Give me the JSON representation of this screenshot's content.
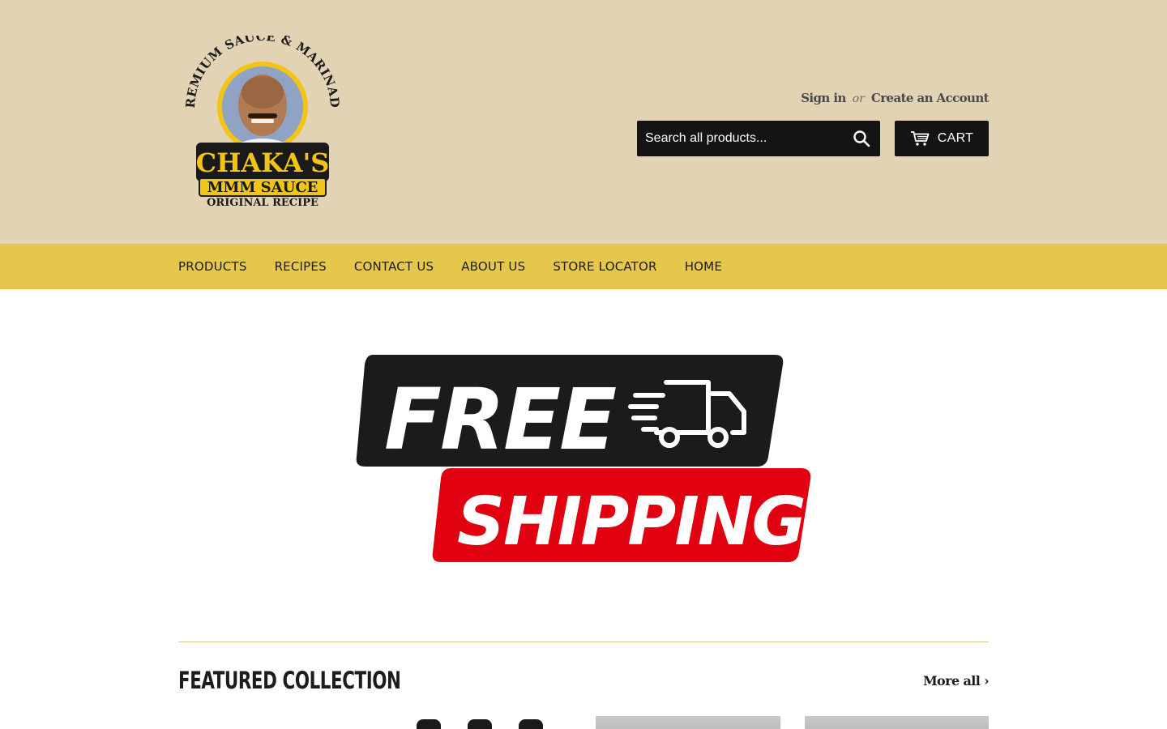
{
  "brand": {
    "logo_arc_text": "PREMIUM SAUCE & MARINADE",
    "logo_name": "CHAKA'S",
    "logo_product": "MMM SAUCE",
    "logo_tagline": "ORIGINAL RECIPE"
  },
  "account": {
    "sign_in": "Sign in",
    "or": "or",
    "create_account": "Create an Account"
  },
  "search": {
    "placeholder": "Search all products...",
    "icon": "search-icon"
  },
  "cart": {
    "label": "CART",
    "icon": "cart-icon"
  },
  "nav": {
    "items": [
      {
        "label": "PRODUCTS"
      },
      {
        "label": "RECIPES"
      },
      {
        "label": "CONTACT US"
      },
      {
        "label": "ABOUT US"
      },
      {
        "label": "STORE LOCATOR"
      },
      {
        "label": "HOME"
      }
    ]
  },
  "hero": {
    "line1": "FREE",
    "line2": "SHIPPING",
    "icon": "truck-icon"
  },
  "featured": {
    "title": "FEATURED COLLECTION",
    "more_label": "More all ›"
  },
  "colors": {
    "header_bg": "#e1d3b4",
    "nav_bg": "#e5c74b",
    "button_bg": "#141414",
    "hero_red": "#e0000f",
    "hero_black": "#1b1b1b",
    "logo_yellow": "#f2c418"
  }
}
